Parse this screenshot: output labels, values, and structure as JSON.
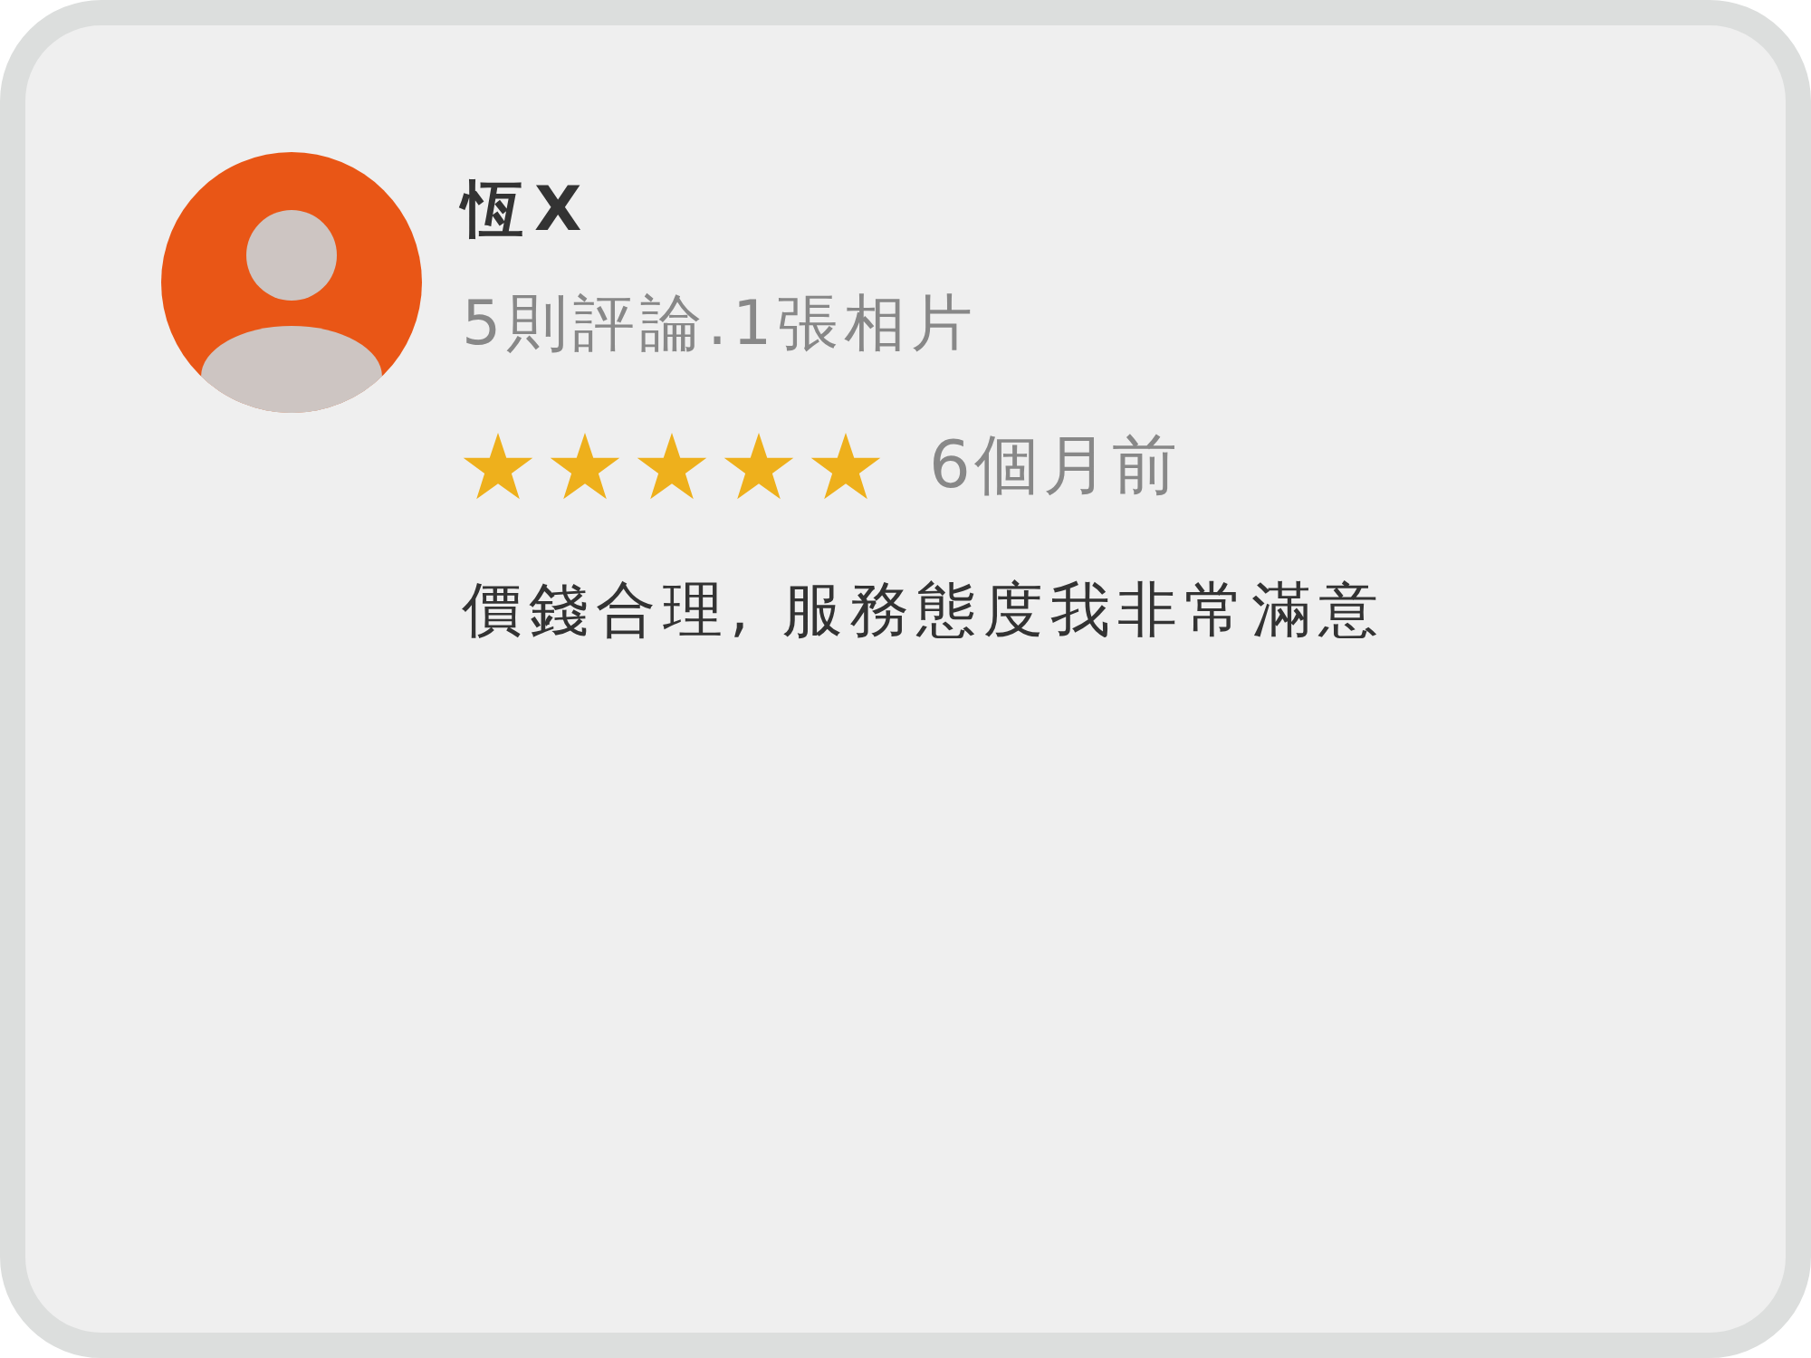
{
  "review": {
    "reviewer_name": "恆X",
    "reviewer_meta": "5則評論.1張相片",
    "stars": 5,
    "time": "6個月前",
    "text": "價錢合理, 服務態度我非常滿意"
  }
}
